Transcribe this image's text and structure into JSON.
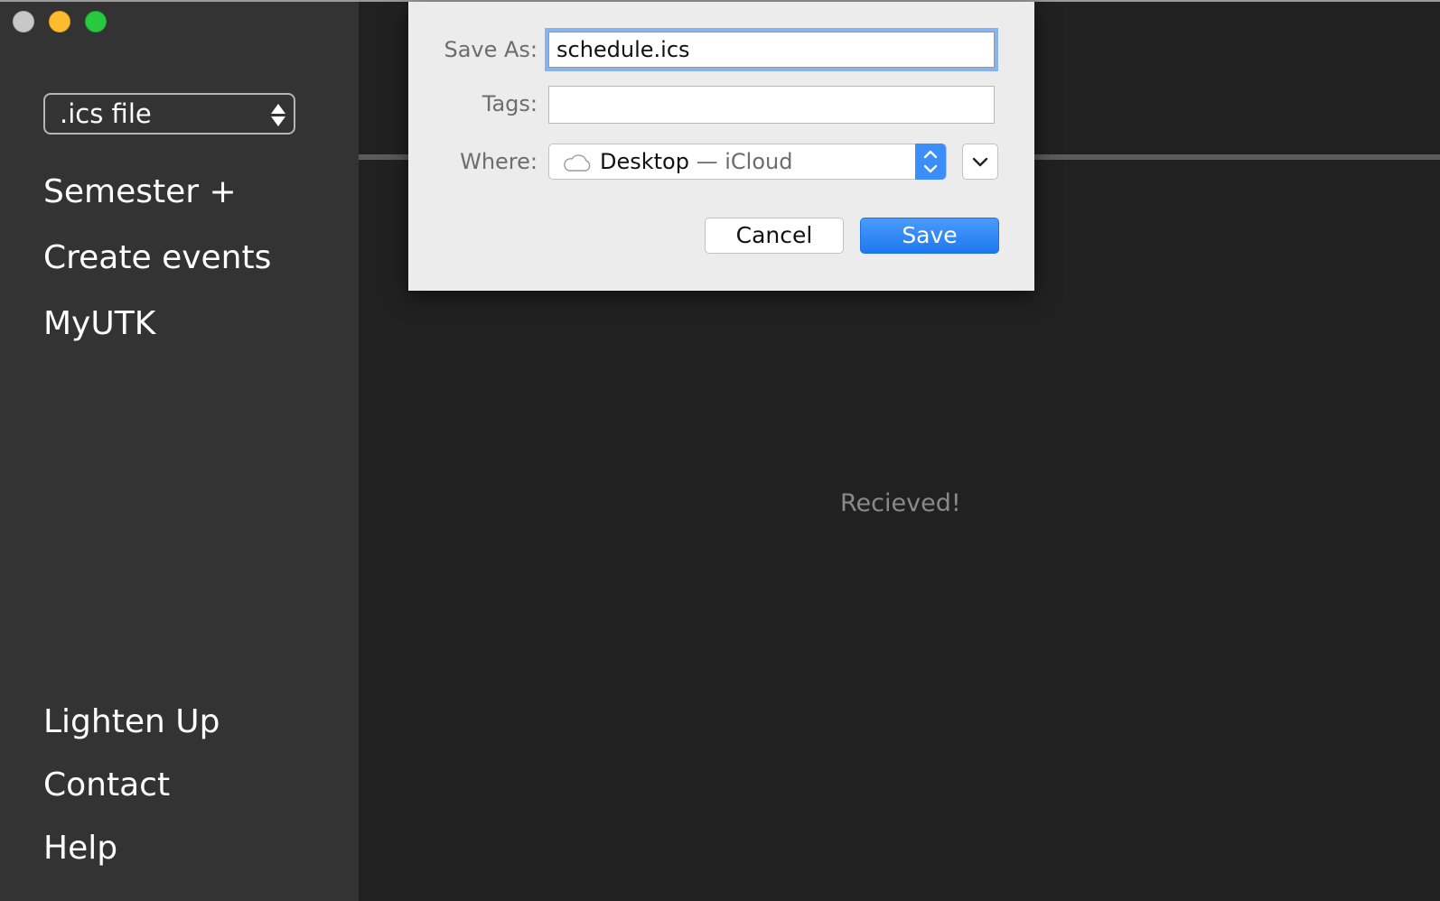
{
  "sidebar": {
    "format_select": {
      "value": ".ics file"
    },
    "nav_top": [
      {
        "label": "Semester +"
      },
      {
        "label": "Create events"
      },
      {
        "label": "MyUTK"
      }
    ],
    "nav_bottom": [
      {
        "label": "Lighten Up"
      },
      {
        "label": "Contact"
      },
      {
        "label": "Help"
      }
    ]
  },
  "main": {
    "status": "Recieved!"
  },
  "save_dialog": {
    "save_as_label": "Save As:",
    "save_as_value": "schedule.ics",
    "tags_label": "Tags:",
    "tags_value": "",
    "where_label": "Where:",
    "where_location": "Desktop",
    "where_suffix": " — iCloud",
    "where_icon": "cloud-icon",
    "cancel_label": "Cancel",
    "save_label": "Save"
  },
  "colors": {
    "sidebar_bg": "#333333",
    "main_bg": "#212121",
    "accent_blue": "#2a83f5",
    "dialog_bg": "#ececec",
    "traffic_close": "#c8c8c8",
    "traffic_minimize": "#febc2e",
    "traffic_maximize": "#28c840"
  }
}
